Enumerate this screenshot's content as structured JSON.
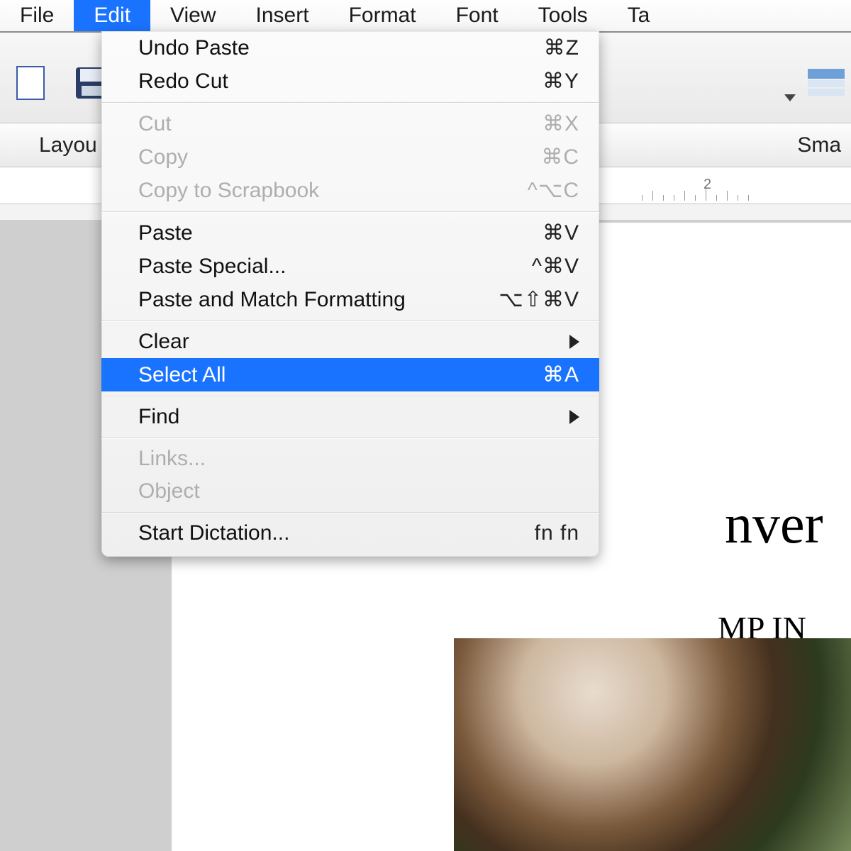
{
  "menubar": {
    "items": [
      {
        "label": "File"
      },
      {
        "label": "Edit",
        "active": true
      },
      {
        "label": "View"
      },
      {
        "label": "Insert"
      },
      {
        "label": "Format"
      },
      {
        "label": "Font"
      },
      {
        "label": "Tools"
      },
      {
        "label": "Ta"
      }
    ]
  },
  "edit_menu": {
    "items": [
      {
        "label": "Undo Paste",
        "shortcut": "⌘Z",
        "enabled": true
      },
      {
        "label": "Redo Cut",
        "shortcut": "⌘Y",
        "enabled": true
      },
      {
        "type": "separator"
      },
      {
        "label": "Cut",
        "shortcut": "⌘X",
        "enabled": false
      },
      {
        "label": "Copy",
        "shortcut": "⌘C",
        "enabled": false
      },
      {
        "label": "Copy to Scrapbook",
        "shortcut": "^⌥C",
        "enabled": false
      },
      {
        "type": "separator"
      },
      {
        "label": "Paste",
        "shortcut": "⌘V",
        "enabled": true
      },
      {
        "label": "Paste Special...",
        "shortcut": "^⌘V",
        "enabled": true
      },
      {
        "label": "Paste and Match Formatting",
        "shortcut": "⌥⇧⌘V",
        "enabled": true
      },
      {
        "type": "separator"
      },
      {
        "label": "Clear",
        "submenu": true,
        "enabled": true
      },
      {
        "label": "Select All",
        "shortcut": "⌘A",
        "enabled": true,
        "highlight": true
      },
      {
        "type": "separator"
      },
      {
        "label": "Find",
        "submenu": true,
        "enabled": true
      },
      {
        "type": "separator"
      },
      {
        "label": "Links...",
        "enabled": false
      },
      {
        "label": "Object",
        "enabled": false
      },
      {
        "type": "separator"
      },
      {
        "label": "Start Dictation...",
        "shortcut": "fn fn",
        "enabled": true
      }
    ]
  },
  "toolbar": {
    "subtabs": {
      "left": "Layou",
      "right": "Sma"
    }
  },
  "ruler": {
    "label": "2"
  },
  "document": {
    "fragment_big": "nver",
    "fragment_mid": "MP IN"
  }
}
